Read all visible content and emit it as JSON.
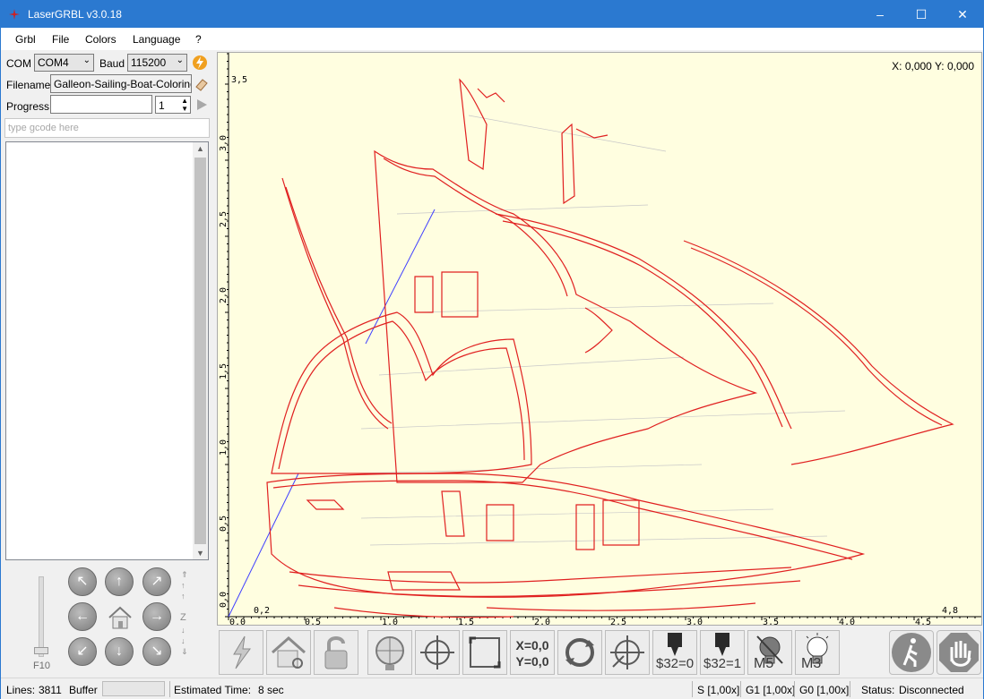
{
  "window": {
    "title": "LaserGRBL v3.0.18"
  },
  "menu": [
    "Grbl",
    "File",
    "Colors",
    "Language",
    "?"
  ],
  "connection": {
    "com_label": "COM",
    "com_value": "COM4",
    "baud_label": "Baud",
    "baud_value": "115200",
    "filename_label": "Filename",
    "filename_value": "Galleon-Sailing-Boat-Coloring-Pa",
    "progress_label": "Progress",
    "copies_value": "1"
  },
  "gcode_input": {
    "placeholder": "type gcode here"
  },
  "jog": {
    "speed_label": "F10",
    "z_label": "Z"
  },
  "canvas": {
    "coord_readout": "X: 0,000 Y: 0,000",
    "x_ticks": [
      "0,0",
      "0,2",
      "0,5",
      "1,0",
      "1,5",
      "2,0",
      "2,5",
      "3,0",
      "3,5",
      "4,0",
      "4,5",
      "4,8"
    ],
    "y_ticks": [
      "0,0",
      "0,5",
      "1,0",
      "1,5",
      "2,0",
      "2,5",
      "3,0",
      "3,5"
    ],
    "y_max_label": "3,5"
  },
  "toolbar": {
    "set_origin_label": "X=0,0\nY=0,0",
    "set_origin_x": "X=0,0",
    "set_origin_y": "Y=0,0",
    "laser_mode_off": "$32=0",
    "laser_mode_on": "$32=1",
    "m5_label": "M5",
    "m3_label": "M3",
    "icons": [
      "connect-icon",
      "home-icon",
      "unlock-icon",
      "globe-icon",
      "center-target-icon",
      "frame-icon",
      "set-origin-icon",
      "rotate-icon",
      "target-zero-icon",
      "laser-mode-off-icon",
      "laser-mode-on-icon",
      "bulb-off-icon",
      "bulb-on-icon",
      "walk-icon",
      "stop-hand-icon"
    ]
  },
  "status": {
    "lines_label": "Lines:",
    "lines_value": "3811",
    "buffer_label": "Buffer",
    "estimated_label": "Estimated Time:",
    "estimated_value": "8 sec",
    "s_override": "S [1,00x]",
    "g1_override": "G1 [1,00x]",
    "g0_override": "G0 [1,00x]",
    "status_label": "Status:",
    "status_value": "Disconnected"
  },
  "colors": {
    "title_bar": "#2b79d0",
    "canvas_bg": "#fffee0",
    "path_red": "#e02020",
    "path_blue": "#4040ff"
  }
}
